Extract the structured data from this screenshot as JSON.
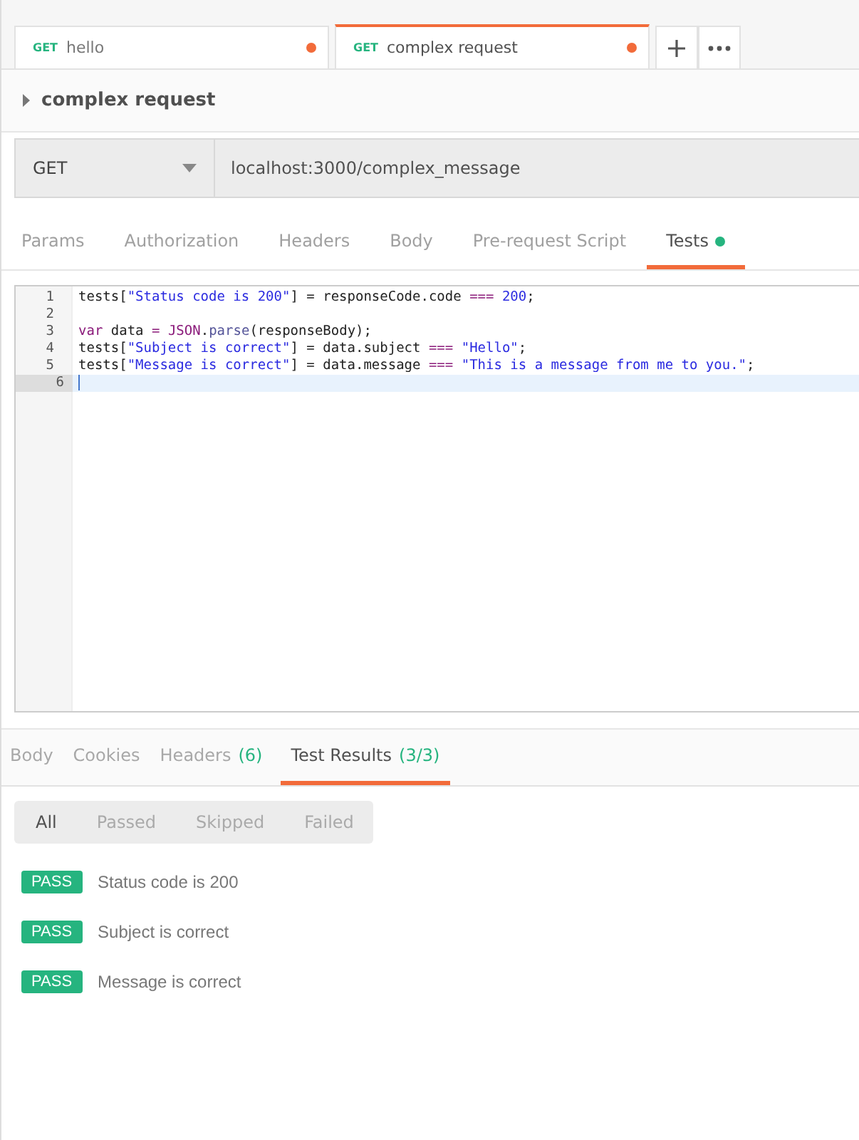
{
  "request_tabs": [
    {
      "method": "GET",
      "name": "hello",
      "unsaved": true,
      "selected": false
    },
    {
      "method": "GET",
      "name": "complex request",
      "unsaved": true,
      "selected": true
    }
  ],
  "request_name": "complex request",
  "url_bar": {
    "method": "GET",
    "url": "localhost:3000/complex_message"
  },
  "request_tabs_nav": [
    {
      "label": "Params",
      "selected": false,
      "has_content": false
    },
    {
      "label": "Authorization",
      "selected": false,
      "has_content": false
    },
    {
      "label": "Headers",
      "selected": false,
      "has_content": false
    },
    {
      "label": "Body",
      "selected": false,
      "has_content": false
    },
    {
      "label": "Pre-request Script",
      "selected": false,
      "has_content": false
    },
    {
      "label": "Tests",
      "selected": true,
      "has_content": true
    }
  ],
  "editor": {
    "lines": [
      {
        "number": "1",
        "active": false,
        "tokens": [
          {
            "kind": "plain",
            "text": "tests["
          },
          {
            "kind": "string",
            "text": "\"Status code is 200\""
          },
          {
            "kind": "plain",
            "text": "] = responseCode.code "
          },
          {
            "kind": "operator",
            "text": "=== "
          },
          {
            "kind": "number",
            "text": "200"
          },
          {
            "kind": "plain",
            "text": ";"
          }
        ]
      },
      {
        "number": "2",
        "active": false
      },
      {
        "number": "3",
        "active": false,
        "tokens": [
          {
            "kind": "keyword",
            "text": "var"
          },
          {
            "kind": "plain",
            "text": " data "
          },
          {
            "kind": "operator",
            "text": "= "
          },
          {
            "kind": "keyword",
            "text": "JSON"
          },
          {
            "kind": "plain",
            "text": "."
          },
          {
            "kind": "property",
            "text": "parse"
          },
          {
            "kind": "plain",
            "text": "(responseBody);"
          }
        ]
      },
      {
        "number": "4",
        "active": false,
        "tokens": [
          {
            "kind": "plain",
            "text": "tests["
          },
          {
            "kind": "string",
            "text": "\"Subject is correct\""
          },
          {
            "kind": "plain",
            "text": "] = data.subject "
          },
          {
            "kind": "operator",
            "text": "=== "
          },
          {
            "kind": "string",
            "text": "\"Hello\""
          },
          {
            "kind": "plain",
            "text": ";"
          }
        ]
      },
      {
        "number": "5",
        "active": false,
        "tokens": [
          {
            "kind": "plain",
            "text": "tests["
          },
          {
            "kind": "string",
            "text": "\"Message is correct\""
          },
          {
            "kind": "plain",
            "text": "] = data.message "
          },
          {
            "kind": "operator",
            "text": "=== "
          },
          {
            "kind": "string",
            "text": "\"This is a message from me to you.\""
          },
          {
            "kind": "plain",
            "text": ";"
          }
        ]
      },
      {
        "number": "6",
        "active": true
      }
    ]
  },
  "response_tabs": [
    {
      "label": "Body",
      "selected": false
    },
    {
      "label": "Cookies",
      "selected": false
    },
    {
      "label": "Headers",
      "count": "(6)",
      "selected": false
    },
    {
      "label": "Test Results",
      "count": "(3/3)",
      "selected": true
    }
  ],
  "result_filters": [
    {
      "label": "All",
      "selected": true
    },
    {
      "label": "Passed",
      "selected": false
    },
    {
      "label": "Skipped",
      "selected": false
    },
    {
      "label": "Failed",
      "selected": false
    }
  ],
  "results": [
    {
      "status": "PASS",
      "kind": "pass",
      "name": "Status code is 200"
    },
    {
      "status": "PASS",
      "kind": "pass",
      "name": "Subject is correct"
    },
    {
      "status": "PASS",
      "kind": "pass",
      "name": "Message is correct"
    }
  ]
}
